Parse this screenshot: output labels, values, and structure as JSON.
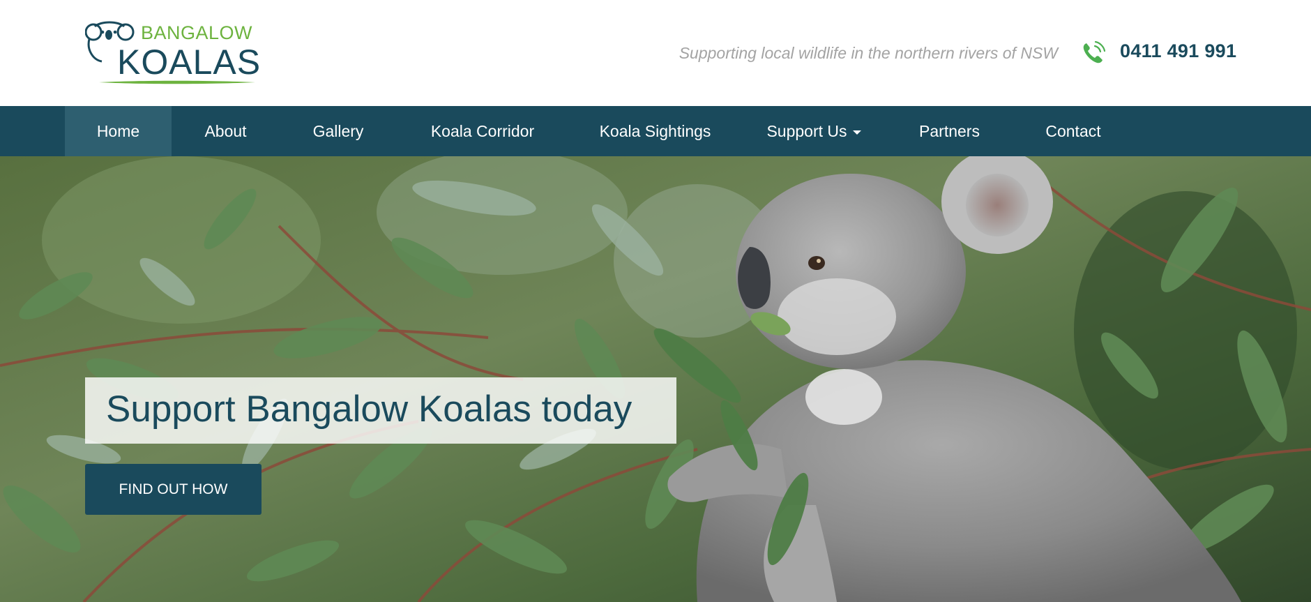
{
  "header": {
    "logo": {
      "top_text": "BANGALOW",
      "bottom_text": "KOALAS",
      "icon": "koala-logo-icon"
    },
    "tagline": "Supporting local wildlife in the northern rivers of NSW",
    "phone": {
      "icon": "phone-icon",
      "number": "0411 491 991"
    }
  },
  "nav": {
    "items": [
      {
        "label": "Home",
        "active": true
      },
      {
        "label": "About"
      },
      {
        "label": "Gallery"
      },
      {
        "label": "Koala Corridor"
      },
      {
        "label": "Koala Sightings"
      },
      {
        "label": "Support Us",
        "has_dropdown": true,
        "icon": "caret-down-icon"
      },
      {
        "label": "Partners"
      },
      {
        "label": "Contact"
      }
    ]
  },
  "hero": {
    "headline": "Support Bangalow Koalas today",
    "button_label": "FIND OUT HOW"
  },
  "colors": {
    "brand_dark": "#1a4a5c",
    "brand_green": "#6db33f",
    "nav_active": "#2e5f70",
    "tagline_gray": "#a3a3a3"
  }
}
